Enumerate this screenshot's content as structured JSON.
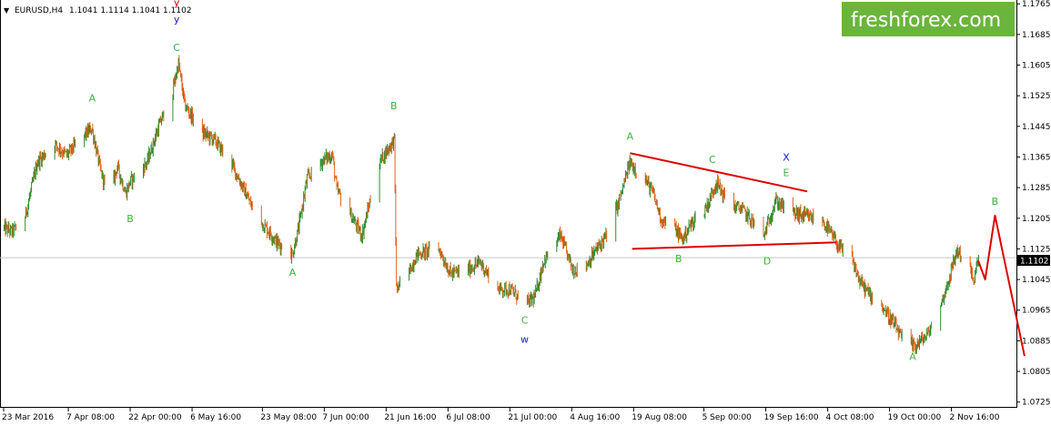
{
  "header": {
    "arrow": "▼",
    "symbol": "EURUSD,H4",
    "ohlc": "1.1041 1.1114 1.1041 1.1102"
  },
  "brand": {
    "text": "freshforex.com",
    "bg_color": "#6ab53c"
  },
  "colors": {
    "bull": "#2e8b2e",
    "bear": "#e2621a",
    "trend": "#dd0000",
    "label_green": "#3cb23c",
    "label_blue": "#1a1acc",
    "label_red": "#dd0000",
    "price_line": "#c8c8c8"
  },
  "chart_data": {
    "type": "candlestick",
    "symbol": "EURUSD",
    "timeframe": "H4",
    "current_price": "1.1102",
    "y_axis": {
      "ylim": [
        1.071,
        1.1775
      ],
      "ticks": [
        "1.1765",
        "1.1685",
        "1.1605",
        "1.1525",
        "1.1445",
        "1.1365",
        "1.1285",
        "1.1205",
        "1.1125",
        "1.1045",
        "1.0965",
        "1.0885",
        "1.0805",
        "1.0725"
      ]
    },
    "x_axis": {
      "range": [
        "2016-03-23 00:00",
        "2016-11-17 00:00"
      ],
      "ticks": [
        {
          "label": "23 Mar 2016",
          "t": "2016-03-23 00:00"
        },
        {
          "label": "7 Apr 08:00",
          "t": "2016-04-07 08:00"
        },
        {
          "label": "22 Apr 00:00",
          "t": "2016-04-22 00:00"
        },
        {
          "label": "6 May 16:00",
          "t": "2016-05-06 16:00"
        },
        {
          "label": "23 May 08:00",
          "t": "2016-05-23 08:00"
        },
        {
          "label": "7 Jun 00:00",
          "t": "2016-06-07 00:00"
        },
        {
          "label": "21 Jun 16:00",
          "t": "2016-06-21 16:00"
        },
        {
          "label": "6 Jul 08:00",
          "t": "2016-07-06 08:00"
        },
        {
          "label": "21 Jul 00:00",
          "t": "2016-07-21 00:00"
        },
        {
          "label": "4 Aug 16:00",
          "t": "2016-08-04 16:00"
        },
        {
          "label": "19 Aug 08:00",
          "t": "2016-08-19 08:00"
        },
        {
          "label": "5 Sep 00:00",
          "t": "2016-09-05 00:00"
        },
        {
          "label": "19 Sep 16:00",
          "t": "2016-09-19 16:00"
        },
        {
          "label": "4 Oct 08:00",
          "t": "2016-10-04 08:00"
        },
        {
          "label": "19 Oct 00:00",
          "t": "2016-10-19 00:00"
        },
        {
          "label": "2 Nov 16:00",
          "t": "2016-11-02 16:00"
        }
      ]
    },
    "price_path": [
      {
        "t": "2016-03-23 00:00",
        "p": 1.118
      },
      {
        "t": "2016-03-25 00:00",
        "p": 1.117
      },
      {
        "t": "2016-03-28 00:00",
        "p": 1.12
      },
      {
        "t": "2016-03-31 00:00",
        "p": 1.135
      },
      {
        "t": "2016-04-04 00:00",
        "p": 1.14
      },
      {
        "t": "2016-04-07 00:00",
        "p": 1.137
      },
      {
        "t": "2016-04-11 00:00",
        "p": 1.142
      },
      {
        "t": "2016-04-13 00:00",
        "p": 1.144
      },
      {
        "t": "2016-04-15 00:00",
        "p": 1.133
      },
      {
        "t": "2016-04-17 00:00",
        "p": 1.126
      },
      {
        "t": "2016-04-19 00:00",
        "p": 1.134
      },
      {
        "t": "2016-04-21 00:00",
        "p": 1.127
      },
      {
        "t": "2016-04-22 00:00",
        "p": 1.13
      },
      {
        "t": "2016-04-26 00:00",
        "p": 1.135
      },
      {
        "t": "2016-04-29 00:00",
        "p": 1.145
      },
      {
        "t": "2016-05-02 00:00",
        "p": 1.153
      },
      {
        "t": "2016-05-03 12:00",
        "p": 1.161
      },
      {
        "t": "2016-05-05 00:00",
        "p": 1.15
      },
      {
        "t": "2016-05-09 00:00",
        "p": 1.143
      },
      {
        "t": "2016-05-12 00:00",
        "p": 1.141
      },
      {
        "t": "2016-05-16 00:00",
        "p": 1.135
      },
      {
        "t": "2016-05-19 00:00",
        "p": 1.128
      },
      {
        "t": "2016-05-22 00:00",
        "p": 1.121
      },
      {
        "t": "2016-05-25 00:00",
        "p": 1.117
      },
      {
        "t": "2016-05-27 00:00",
        "p": 1.114
      },
      {
        "t": "2016-05-30 12:00",
        "p": 1.111
      },
      {
        "t": "2016-06-01 00:00",
        "p": 1.118
      },
      {
        "t": "2016-06-03 00:00",
        "p": 1.131
      },
      {
        "t": "2016-06-07 00:00",
        "p": 1.136
      },
      {
        "t": "2016-06-09 00:00",
        "p": 1.137
      },
      {
        "t": "2016-06-10 00:00",
        "p": 1.128
      },
      {
        "t": "2016-06-13 00:00",
        "p": 1.122
      },
      {
        "t": "2016-06-16 00:00",
        "p": 1.116
      },
      {
        "t": "2016-06-20 00:00",
        "p": 1.135
      },
      {
        "t": "2016-06-23 16:00",
        "p": 1.141
      },
      {
        "t": "2016-06-24 04:00",
        "p": 1.102
      },
      {
        "t": "2016-06-27 00:00",
        "p": 1.106
      },
      {
        "t": "2016-06-29 00:00",
        "p": 1.111
      },
      {
        "t": "2016-07-04 00:00",
        "p": 1.113
      },
      {
        "t": "2016-07-07 00:00",
        "p": 1.106
      },
      {
        "t": "2016-07-11 00:00",
        "p": 1.107
      },
      {
        "t": "2016-07-14 00:00",
        "p": 1.109
      },
      {
        "t": "2016-07-18 00:00",
        "p": 1.102
      },
      {
        "t": "2016-07-21 00:00",
        "p": 1.102
      },
      {
        "t": "2016-07-25 00:00",
        "p": 1.098
      },
      {
        "t": "2016-07-27 00:00",
        "p": 1.1
      },
      {
        "t": "2016-07-29 00:00",
        "p": 1.109
      },
      {
        "t": "2016-08-02 00:00",
        "p": 1.116
      },
      {
        "t": "2016-08-05 00:00",
        "p": 1.107
      },
      {
        "t": "2016-08-08 00:00",
        "p": 1.108
      },
      {
        "t": "2016-08-11 00:00",
        "p": 1.113
      },
      {
        "t": "2016-08-13 00:00",
        "p": 1.116
      },
      {
        "t": "2016-08-16 00:00",
        "p": 1.125
      },
      {
        "t": "2016-08-18 12:00",
        "p": 1.135
      },
      {
        "t": "2016-08-22 00:00",
        "p": 1.131
      },
      {
        "t": "2016-08-24 00:00",
        "p": 1.127
      },
      {
        "t": "2016-08-26 00:00",
        "p": 1.12
      },
      {
        "t": "2016-08-29 00:00",
        "p": 1.118
      },
      {
        "t": "2016-08-31 00:00",
        "p": 1.115
      },
      {
        "t": "2016-09-02 00:00",
        "p": 1.119
      },
      {
        "t": "2016-09-06 00:00",
        "p": 1.124
      },
      {
        "t": "2016-09-08 00:00",
        "p": 1.13
      },
      {
        "t": "2016-09-11 00:00",
        "p": 1.124
      },
      {
        "t": "2016-09-14 00:00",
        "p": 1.123
      },
      {
        "t": "2016-09-17 00:00",
        "p": 1.119
      },
      {
        "t": "2016-09-19 00:00",
        "p": 1.115
      },
      {
        "t": "2016-09-22 00:00",
        "p": 1.125
      },
      {
        "t": "2016-09-26 00:00",
        "p": 1.122
      },
      {
        "t": "2016-09-29 00:00",
        "p": 1.121
      },
      {
        "t": "2016-10-03 00:00",
        "p": 1.12
      },
      {
        "t": "2016-10-06 00:00",
        "p": 1.115
      },
      {
        "t": "2016-10-07 00:00",
        "p": 1.113
      },
      {
        "t": "2016-10-10 00:00",
        "p": 1.11
      },
      {
        "t": "2016-10-12 00:00",
        "p": 1.104
      },
      {
        "t": "2016-10-14 00:00",
        "p": 1.101
      },
      {
        "t": "2016-10-17 00:00",
        "p": 1.098
      },
      {
        "t": "2016-10-20 00:00",
        "p": 1.093
      },
      {
        "t": "2016-10-22 00:00",
        "p": 1.089
      },
      {
        "t": "2016-10-25 00:00",
        "p": 1.087
      },
      {
        "t": "2016-10-28 00:00",
        "p": 1.09
      },
      {
        "t": "2016-10-31 00:00",
        "p": 1.097
      },
      {
        "t": "2016-11-02 00:00",
        "p": 1.104
      },
      {
        "t": "2016-11-04 00:00",
        "p": 1.112
      },
      {
        "t": "2016-11-07 00:00",
        "p": 1.109
      },
      {
        "t": "2016-11-08 00:00",
        "p": 1.103
      },
      {
        "t": "2016-11-09 00:00",
        "p": 1.11
      }
    ],
    "trend_lines": [
      {
        "from": {
          "t": "2016-08-18 12:00",
          "p": 1.1375
        },
        "to": {
          "t": "2016-09-29 12:00",
          "p": 1.1275
        }
      },
      {
        "from": {
          "t": "2016-08-19 00:00",
          "p": 1.1125
        },
        "to": {
          "t": "2016-10-06 12:00",
          "p": 1.1142
        }
      }
    ],
    "forecast_path": [
      {
        "t": "2016-11-09 00:00",
        "p": 1.1095
      },
      {
        "t": "2016-11-10 16:00",
        "p": 1.1045
      },
      {
        "t": "2016-11-13 00:00",
        "p": 1.1212
      },
      {
        "t": "2016-11-20 00:00",
        "p": 1.0845
      }
    ],
    "annotations": [
      {
        "text": "y",
        "color": "red",
        "t": "2016-05-03 00:00",
        "p": 1.176
      },
      {
        "text": "y",
        "color": "blue",
        "t": "2016-05-03 00:00",
        "p": 1.1715
      },
      {
        "text": "C",
        "color": "green",
        "t": "2016-05-03 00:00",
        "p": 1.1642
      },
      {
        "text": "A",
        "color": "green",
        "t": "2016-04-13 00:00",
        "p": 1.151
      },
      {
        "text": "B",
        "color": "green",
        "t": "2016-04-22 00:00",
        "p": 1.1195
      },
      {
        "text": "A",
        "color": "green",
        "t": "2016-05-30 12:00",
        "p": 1.1055
      },
      {
        "text": "B",
        "color": "green",
        "t": "2016-06-23 12:00",
        "p": 1.149
      },
      {
        "text": "C",
        "color": "green",
        "t": "2016-07-24 12:00",
        "p": 1.093
      },
      {
        "text": "w",
        "color": "blue",
        "t": "2016-07-24 12:00",
        "p": 1.088
      },
      {
        "text": "A",
        "color": "green",
        "t": "2016-08-18 12:00",
        "p": 1.141
      },
      {
        "text": "B",
        "color": "green",
        "t": "2016-08-30 00:00",
        "p": 1.109
      },
      {
        "text": "C",
        "color": "green",
        "t": "2016-09-07 00:00",
        "p": 1.135
      },
      {
        "text": "D",
        "color": "green",
        "t": "2016-09-20 00:00",
        "p": 1.1085
      },
      {
        "text": "X",
        "color": "blue",
        "t": "2016-09-24 12:00",
        "p": 1.1355
      },
      {
        "text": "E",
        "color": "green",
        "t": "2016-09-24 12:00",
        "p": 1.1315
      },
      {
        "text": "A",
        "color": "green",
        "t": "2016-10-24 12:00",
        "p": 1.0835
      },
      {
        "text": "B",
        "color": "green",
        "t": "2016-11-13 00:00",
        "p": 1.124
      }
    ]
  }
}
